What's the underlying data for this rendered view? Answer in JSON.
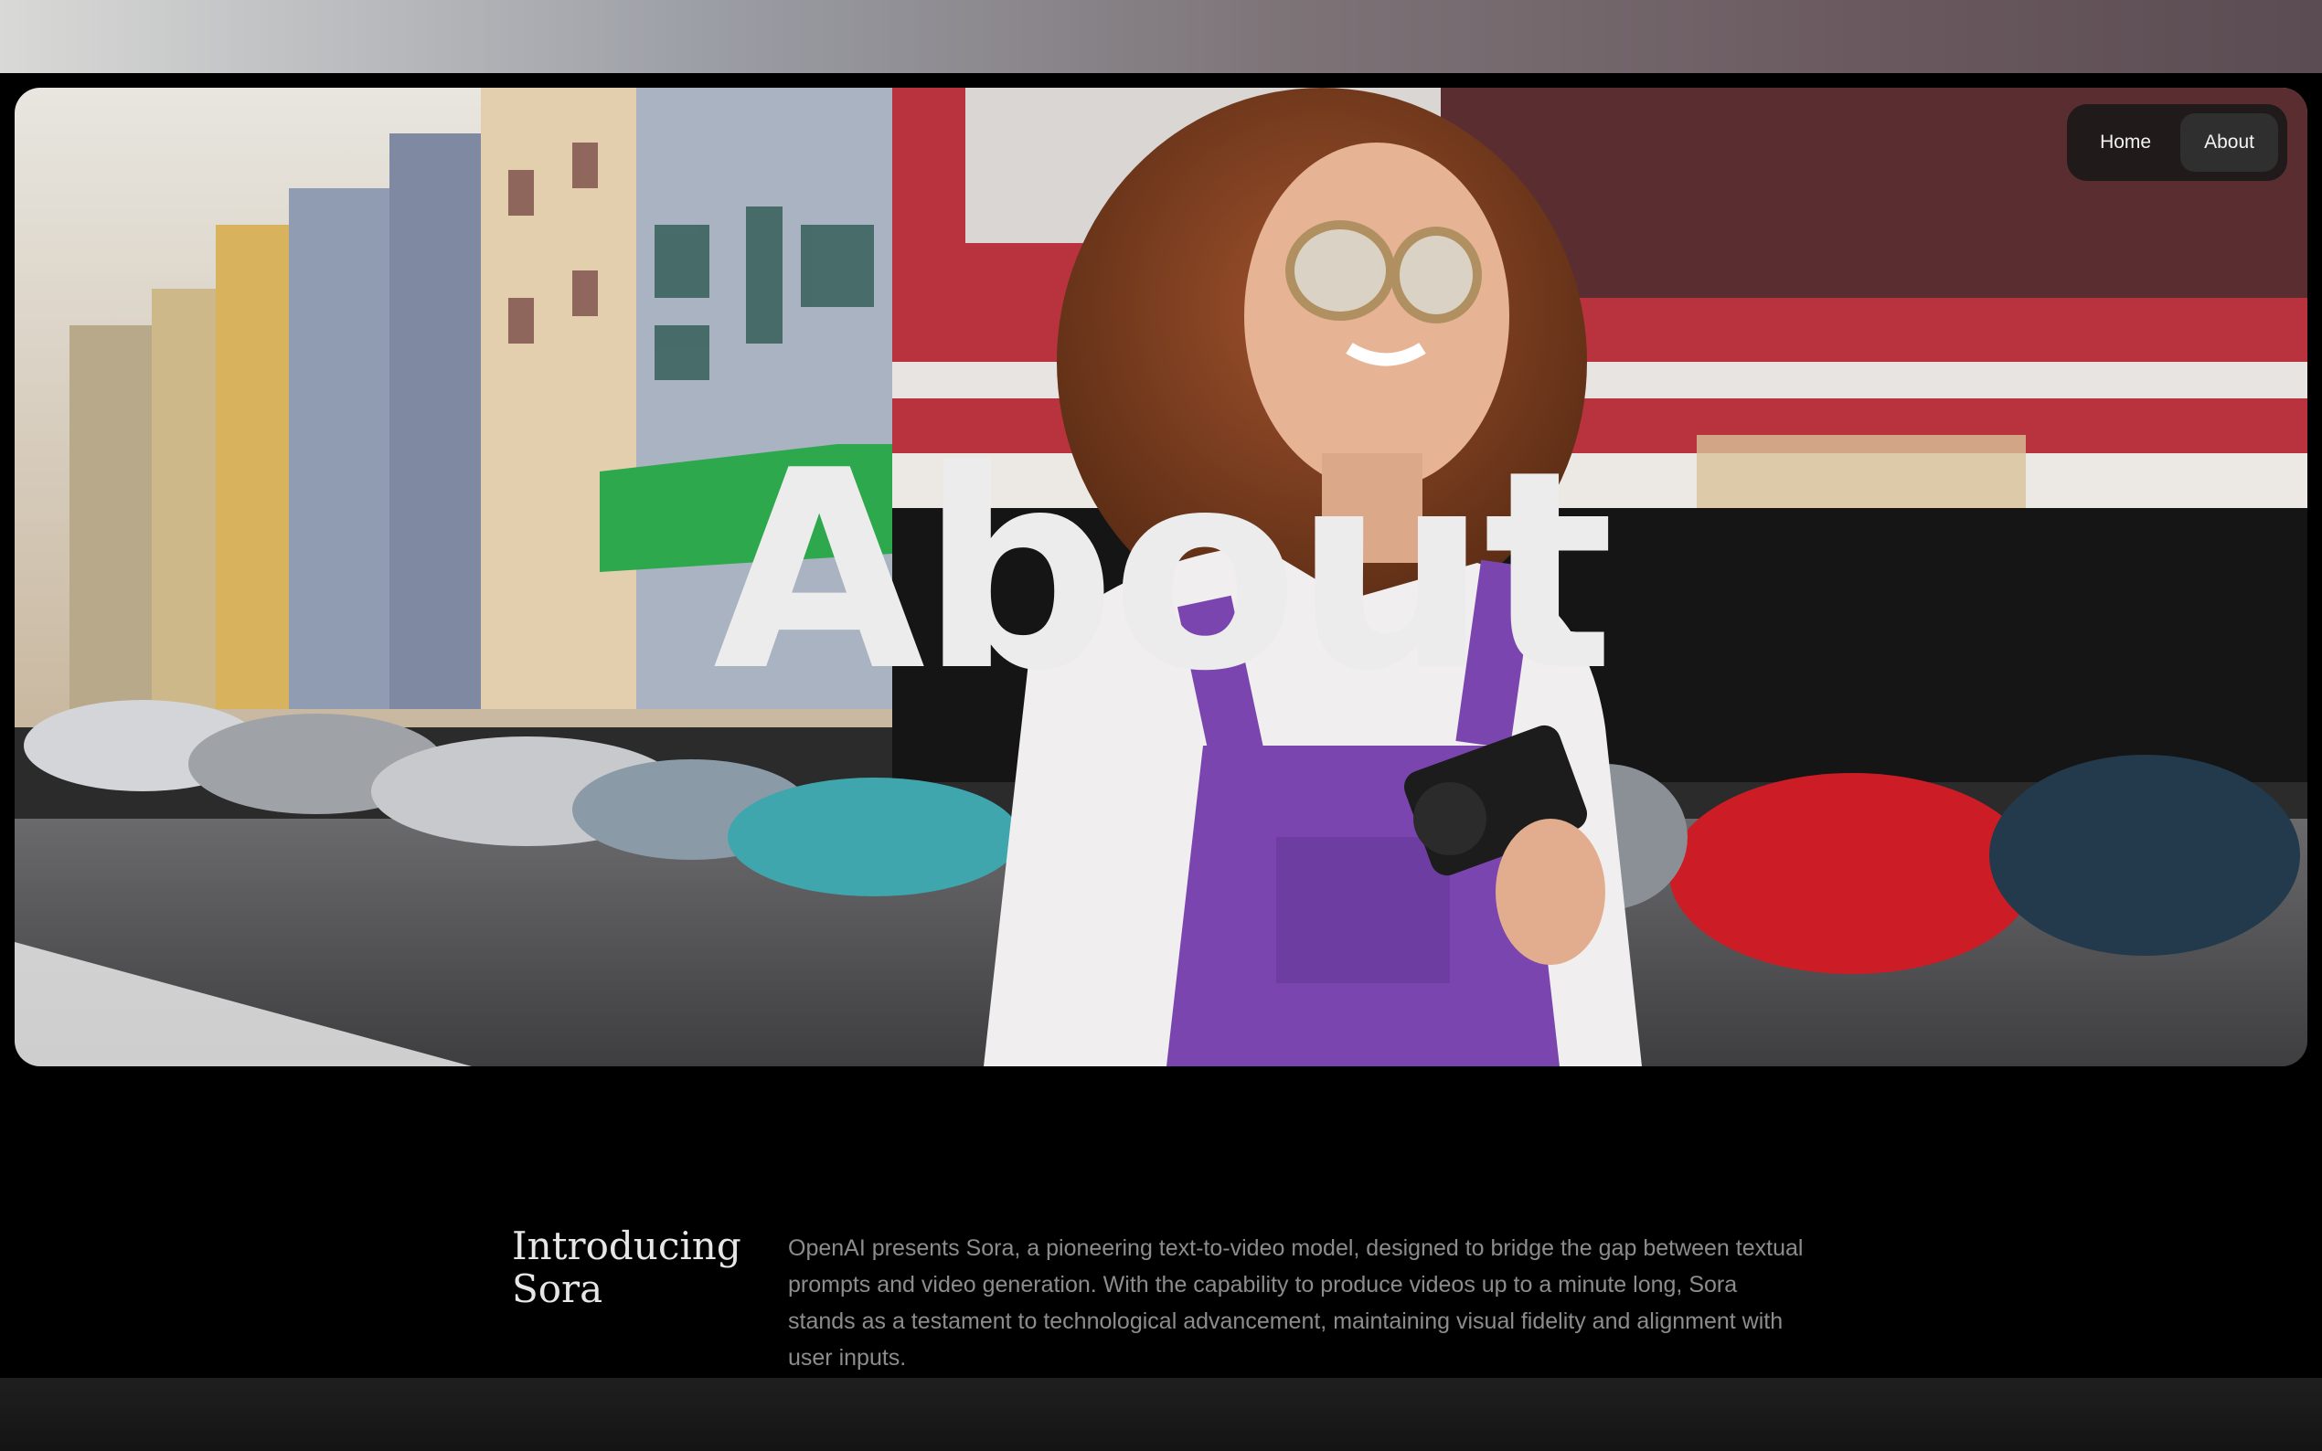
{
  "nav": {
    "items": [
      {
        "label": "Home"
      },
      {
        "label": "About"
      }
    ],
    "active": "About"
  },
  "hero": {
    "title": "About",
    "image": "woman-with-camera-street-photo"
  },
  "intro": {
    "heading_line1": "Introducing",
    "heading_line2": "Sora",
    "body": "OpenAI presents Sora, a pioneering text-to-video model, designed to bridge the gap between textual prompts and video generation. With the capability to produce videos up to a minute long, Sora stands as a testament to technological advancement, maintaining visual fidelity and alignment with user inputs."
  },
  "colors": {
    "background": "#000000",
    "title": "#ececec",
    "body_text": "#8c8c8c",
    "nav_bg": "#181818",
    "accent_purple": "#7b45b0"
  }
}
